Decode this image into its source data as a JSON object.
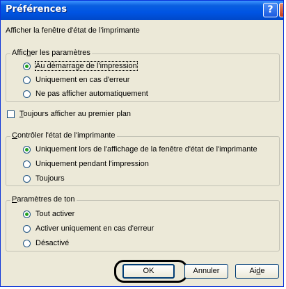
{
  "window": {
    "title": "Préférences"
  },
  "titlebar": {
    "help_glyph": "?",
    "close_glyph": "X"
  },
  "intro_label": "Afficher la fenêtre d'état de l'imprimante",
  "group_display": {
    "legend_pre": "Affic",
    "legend_key": "h",
    "legend_post": "er les paramètres",
    "options": [
      {
        "label": "Au démarrage de l'impression",
        "selected": true
      },
      {
        "label": "Uniquement en cas d'erreur",
        "selected": false
      },
      {
        "label": "Ne pas afficher automatiquement",
        "selected": false
      }
    ]
  },
  "always_on_top": {
    "key": "T",
    "rest": "oujours afficher au premier plan",
    "checked": false
  },
  "group_monitor": {
    "legend_key": "C",
    "legend_rest": "ontrôler l'état de l'imprimante",
    "options": [
      {
        "label": "Uniquement lors de l'affichage de la fenêtre d'état de l'imprimante",
        "selected": true
      },
      {
        "label": "Uniquement pendant l'impression",
        "selected": false
      },
      {
        "label": "Toujours",
        "selected": false
      }
    ]
  },
  "group_sound": {
    "legend_key": "P",
    "legend_rest": "aramètres de ton",
    "options": [
      {
        "label": "Tout activer",
        "selected": true
      },
      {
        "label": "Activer uniquement en cas d'erreur",
        "selected": false
      },
      {
        "label": "Désactivé",
        "selected": false
      }
    ]
  },
  "buttons": {
    "ok": "OK",
    "cancel": "Annuler",
    "help_pre": "Ai",
    "help_key": "d",
    "help_post": "e"
  }
}
